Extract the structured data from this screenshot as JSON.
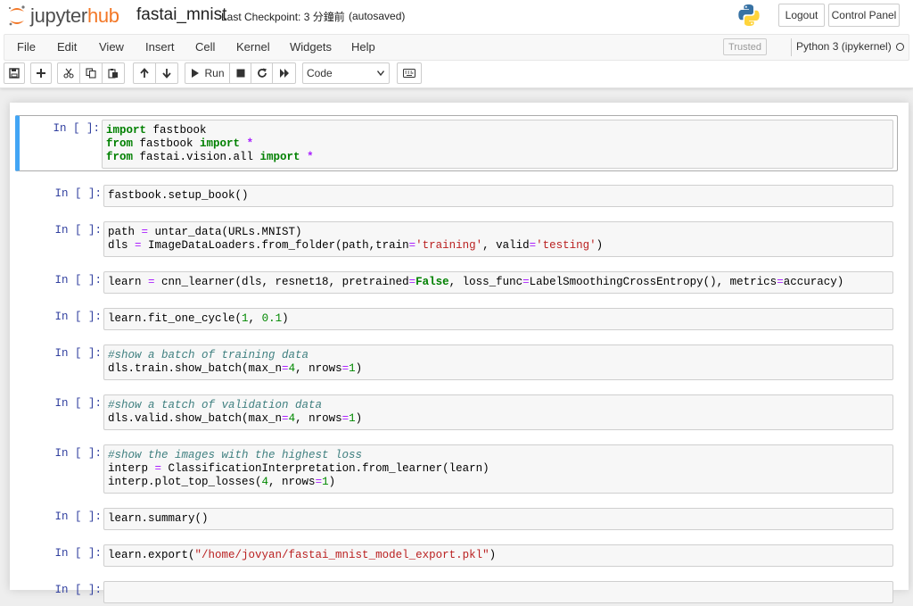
{
  "header": {
    "logo_prefix": "jupyter",
    "logo_suffix": "hub",
    "notebook_name": "fastai_mnist",
    "checkpoint": "Last Checkpoint: 3 分鐘前",
    "autosaved": "(autosaved)",
    "logout_label": "Logout",
    "control_panel_label": "Control Panel",
    "brand_color": "#f37726"
  },
  "menubar": {
    "items": [
      "File",
      "Edit",
      "View",
      "Insert",
      "Cell",
      "Kernel",
      "Widgets",
      "Help"
    ],
    "trusted_label": "Trusted",
    "kernel_name": "Python 3 (ipykernel)"
  },
  "toolbar": {
    "buttons": [
      "save-icon",
      "plus-icon",
      "cut-icon",
      "copy-icon",
      "paste-icon",
      "arrow-up-icon",
      "arrow-down-icon",
      "run-icon",
      "stop-icon",
      "restart-icon",
      "fast-forward-icon",
      "keyboard-icon"
    ],
    "run_label": "Run",
    "cell_type": "Code"
  },
  "cells": [
    {
      "prompt": "In [ ]:",
      "selected": true,
      "lines": [
        [
          [
            "kw",
            "import"
          ],
          [
            "",
            " fastbook"
          ]
        ],
        [
          [
            "kw",
            "from"
          ],
          [
            "",
            " fastbook "
          ],
          [
            "kw",
            "import"
          ],
          [
            "",
            " "
          ],
          [
            "op",
            "*"
          ]
        ],
        [
          [
            "kw",
            "from"
          ],
          [
            "",
            " fastai.vision.all "
          ],
          [
            "kw",
            "import"
          ],
          [
            "",
            " "
          ],
          [
            "op",
            "*"
          ]
        ]
      ]
    },
    {
      "prompt": "In [ ]:",
      "lines": [
        [
          [
            "",
            "fastbook.setup_book()"
          ]
        ]
      ]
    },
    {
      "prompt": "In [ ]:",
      "lines": [
        [
          [
            "",
            "path "
          ],
          [
            "eq",
            "="
          ],
          [
            "",
            " untar_data(URLs.MNIST)"
          ]
        ],
        [
          [
            "",
            "dls "
          ],
          [
            "eq",
            "="
          ],
          [
            "",
            " ImageDataLoaders.from_folder(path,train"
          ],
          [
            "eq",
            "="
          ],
          [
            "str",
            "'training'"
          ],
          [
            "",
            ", valid"
          ],
          [
            "eq",
            "="
          ],
          [
            "str",
            "'testing'"
          ],
          [
            "",
            ")"
          ]
        ]
      ]
    },
    {
      "prompt": "In [ ]:",
      "lines": [
        [
          [
            "",
            "learn "
          ],
          [
            "eq",
            "="
          ],
          [
            "",
            " cnn_learner(dls, resnet18, pretrained"
          ],
          [
            "eq",
            "="
          ],
          [
            "kw",
            "False"
          ],
          [
            "",
            ", loss_func"
          ],
          [
            "eq",
            "="
          ],
          [
            "",
            "LabelSmoothingCrossEntropy(), metrics"
          ],
          [
            "eq",
            "="
          ],
          [
            "",
            "accuracy)"
          ]
        ]
      ]
    },
    {
      "prompt": "In [ ]:",
      "lines": [
        [
          [
            "",
            "learn.fit_one_cycle("
          ],
          [
            "num",
            "1"
          ],
          [
            "",
            ", "
          ],
          [
            "num",
            "0.1"
          ],
          [
            "",
            ")"
          ]
        ]
      ]
    },
    {
      "prompt": "In [ ]:",
      "lines": [
        [
          [
            "cm",
            "#show a batch of training data"
          ]
        ],
        [
          [
            "",
            "dls.train.show_batch(max_n"
          ],
          [
            "eq",
            "="
          ],
          [
            "num",
            "4"
          ],
          [
            "",
            ", nrows"
          ],
          [
            "eq",
            "="
          ],
          [
            "num",
            "1"
          ],
          [
            "",
            ")"
          ]
        ]
      ]
    },
    {
      "prompt": "In [ ]:",
      "lines": [
        [
          [
            "cm",
            "#show a tatch of validation data"
          ]
        ],
        [
          [
            "",
            "dls.valid.show_batch(max_n"
          ],
          [
            "eq",
            "="
          ],
          [
            "num",
            "4"
          ],
          [
            "",
            ", nrows"
          ],
          [
            "eq",
            "="
          ],
          [
            "num",
            "1"
          ],
          [
            "",
            ")"
          ]
        ]
      ]
    },
    {
      "prompt": "In [ ]:",
      "lines": [
        [
          [
            "cm",
            "#show the images with the highest loss"
          ]
        ],
        [
          [
            "",
            "interp "
          ],
          [
            "eq",
            "="
          ],
          [
            "",
            " ClassificationInterpretation.from_learner(learn)"
          ]
        ],
        [
          [
            "",
            "interp.plot_top_losses("
          ],
          [
            "num",
            "4"
          ],
          [
            "",
            ", nrows"
          ],
          [
            "eq",
            "="
          ],
          [
            "num",
            "1"
          ],
          [
            "",
            ")"
          ]
        ]
      ]
    },
    {
      "prompt": "In [ ]:",
      "lines": [
        [
          [
            "",
            "learn.summary()"
          ]
        ]
      ]
    },
    {
      "prompt": "In [ ]:",
      "lines": [
        [
          [
            "",
            "learn.export("
          ],
          [
            "str",
            "\"/home/jovyan/fastai_mnist_model_export.pkl\""
          ],
          [
            "",
            ")"
          ]
        ]
      ]
    },
    {
      "prompt": "In [ ]:",
      "lines": [
        [
          [
            "",
            ""
          ]
        ]
      ]
    }
  ]
}
